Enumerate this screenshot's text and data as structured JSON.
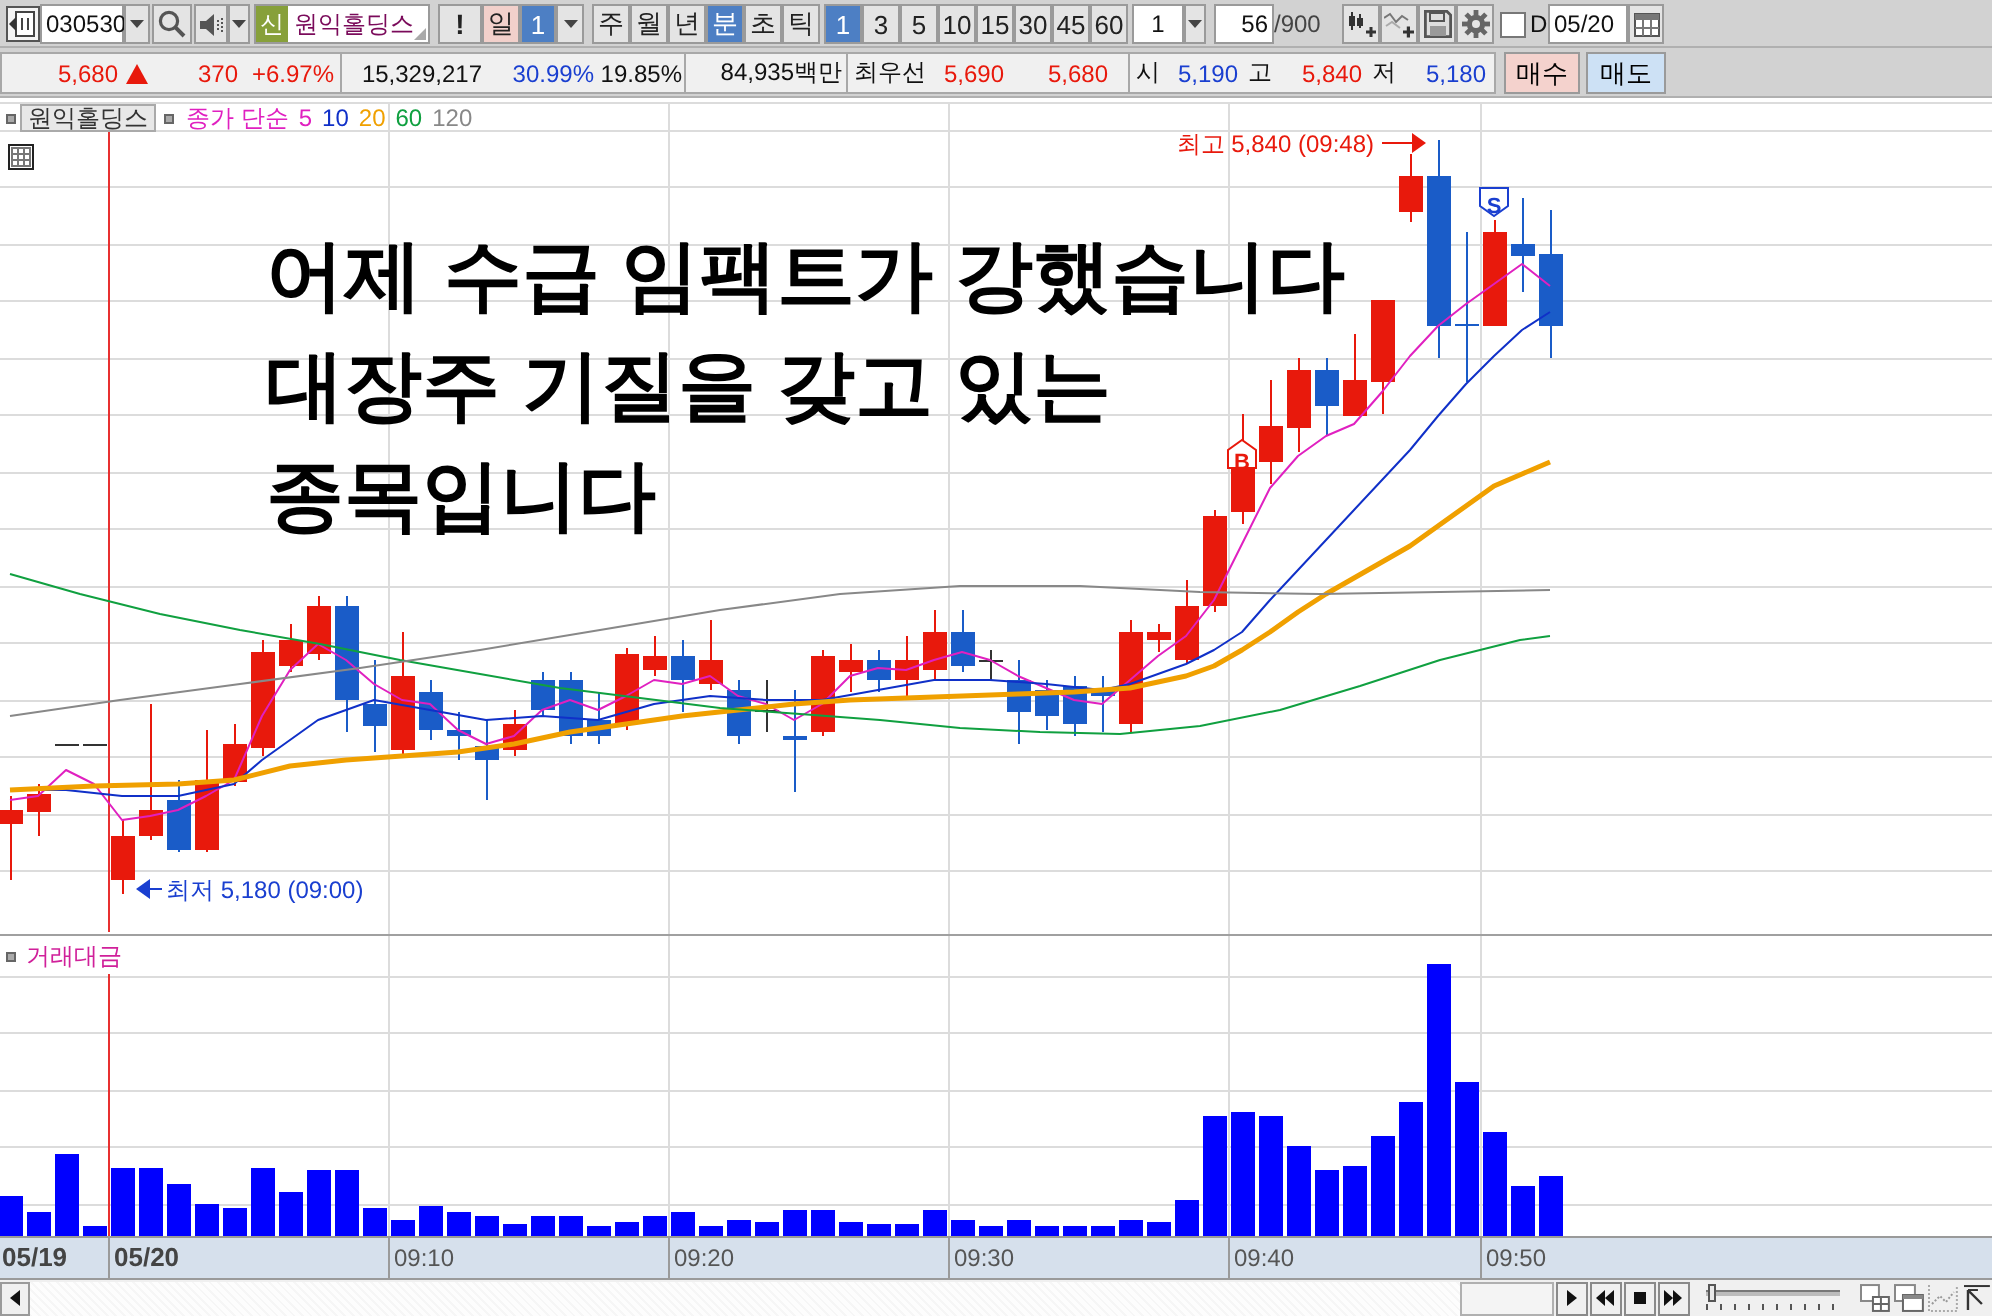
{
  "toolbar": {
    "code": "030530",
    "name_badge": "신",
    "stock_name": "원익홀딩스",
    "alert_button": "!",
    "day_button": {
      "label": "일",
      "highlighted": true
    },
    "day_count": "1",
    "period_buttons": [
      {
        "label": "주",
        "selected": false
      },
      {
        "label": "월",
        "selected": false
      },
      {
        "label": "년",
        "selected": false
      },
      {
        "label": "분",
        "selected": true
      },
      {
        "label": "초",
        "selected": false
      },
      {
        "label": "틱",
        "selected": false
      }
    ],
    "interval_buttons": [
      {
        "label": "1",
        "selected": true
      },
      {
        "label": "3",
        "selected": false
      },
      {
        "label": "5",
        "selected": false
      },
      {
        "label": "10",
        "selected": false
      },
      {
        "label": "15",
        "selected": false
      },
      {
        "label": "30",
        "selected": false
      },
      {
        "label": "45",
        "selected": false
      },
      {
        "label": "60",
        "selected": false
      }
    ],
    "interval_value": "1",
    "count_value": "56",
    "count_total": "/900",
    "d_checkbox": {
      "label": "D",
      "checked": false
    },
    "date_value": "05/20"
  },
  "quote": {
    "price": "5,680",
    "rising": true,
    "change": "370",
    "change_rate": "+6.97%",
    "volume": "15,329,217",
    "rate_a": "30.99%",
    "rate_b": "19.85%",
    "amount": "84,935백만",
    "best_label": "최우선",
    "best_ask": "5,690",
    "best_bid": "5,680",
    "open_label": "시",
    "open": "5,190",
    "high_label": "고",
    "high": "5,840",
    "low_label": "저",
    "low": "5,180",
    "buy_button": "매수",
    "sell_button": "매도"
  },
  "chart": {
    "stock_tab": "원익홀딩스",
    "legend": {
      "label": "종가 단순",
      "periods": [
        {
          "text": "5",
          "color": "#e020c0"
        },
        {
          "text": "10",
          "color": "#1030c8"
        },
        {
          "text": "20",
          "color": "#f0a000"
        },
        {
          "text": "60",
          "color": "#10a040"
        },
        {
          "text": "120",
          "color": "#888888"
        }
      ]
    },
    "caption": [
      "어제 수급 임팩트가 강했습니다",
      "대장주 기질을 갖고 있는",
      "종목입니다"
    ],
    "high_note": "최고 5,840 (09:48)",
    "low_note": "최저 5,180 (09:00)",
    "signals": [
      {
        "kind": "buy",
        "label": "B"
      },
      {
        "kind": "sell",
        "label": "S"
      }
    ],
    "volume_title": "거래대금"
  },
  "time_axis": [
    {
      "label": "05/19",
      "kind": "date"
    },
    {
      "label": "05/20",
      "kind": "date"
    },
    {
      "label": "09:10",
      "kind": "time"
    },
    {
      "label": "09:20",
      "kind": "time"
    },
    {
      "label": "09:30",
      "kind": "time"
    },
    {
      "label": "09:40",
      "kind": "time"
    },
    {
      "label": "09:50",
      "kind": "time"
    }
  ],
  "playback": {
    "speed": {
      "level": 0.05
    }
  }
}
